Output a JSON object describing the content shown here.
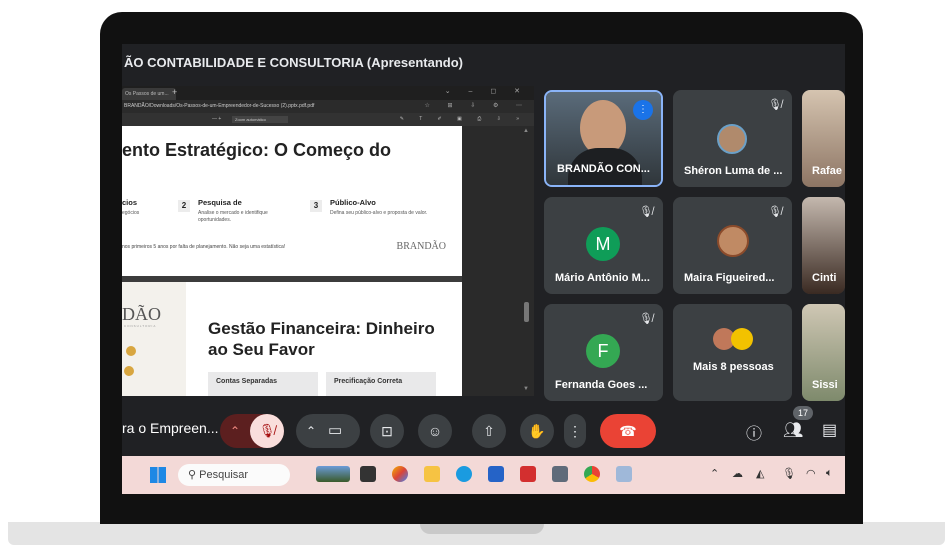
{
  "meeting": {
    "title": "ÃO CONTABILIDADE E CONSULTORIA (Apresentando)",
    "meeting_name": "ra o Empreen...",
    "participant_count": "17"
  },
  "pdf_viewer": {
    "tab_label": "Os Passos de um...",
    "url": "BRANDÃO/Downloads/Os-Passos-de-um-Empreendedor-de-Sucesso (2).pptx.pdf.pdf",
    "zoom_label": "Zoom automático",
    "zoom_controls": "—  +"
  },
  "slide1": {
    "title": "ento Estratégico: O Começo do",
    "col1_title": "cios",
    "col1_text": "egócios",
    "step2_number": "2",
    "step2_title": "Pesquisa de",
    "step2_text": "Analise o mercado e identifique oportunidades.",
    "step3_number": "3",
    "step3_title": "Público-Alvo",
    "step3_text": "Defina seu público-alvo e proposta de valor.",
    "footer": "nos primeiros 5 anos por falta de planejamento. Não seja uma estatística!",
    "logo": "BRANDÃO"
  },
  "slide2": {
    "brand": "DÃO",
    "brand_sub": "CONSULTORIA",
    "title": "Gestão Financeira: Dinheiro ao Seu Favor",
    "card1": "Contas Separadas",
    "card2": "Precificação Correta"
  },
  "participants": [
    {
      "name": "BRANDÃO CON...",
      "speaking": true
    },
    {
      "name": "Shéron Luma de ...",
      "muted": true
    },
    {
      "name": "Rafae"
    },
    {
      "name": "Mário Antônio M...",
      "initial": "M",
      "color": "#0f9d58",
      "muted": true
    },
    {
      "name": "Maira Figueired...",
      "muted": true
    },
    {
      "name": "Cinti"
    },
    {
      "name": "Fernanda Goes ...",
      "initial": "F",
      "color": "#34a853",
      "muted": true
    },
    {
      "name": "Mais 8 pessoas"
    },
    {
      "name": "Sissi"
    }
  ],
  "taskbar": {
    "search_placeholder": "Pesquisar"
  },
  "colors": {
    "meet_bg": "#202124",
    "tile_bg": "#3c4043",
    "mic_off_red": "#f28b82",
    "end_call_red": "#ea4335",
    "taskbar_bg": "#f3d9d7"
  }
}
